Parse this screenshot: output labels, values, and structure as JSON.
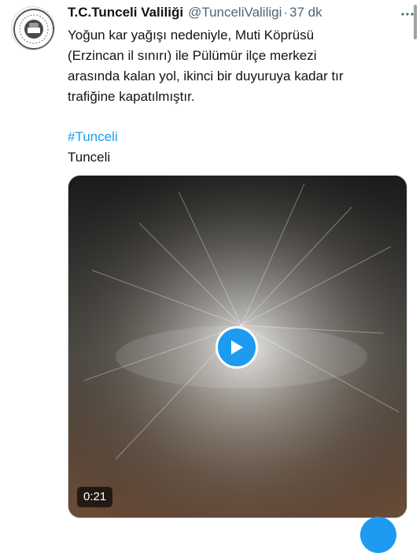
{
  "author": {
    "name": "T.C.Tunceli Valiliği",
    "handle": "@TunceliValiligi",
    "separator": "·",
    "time": "37 dk"
  },
  "tweet": {
    "text": "Yoğun kar yağışı nedeniyle, Muti Köprüsü\n(Erzincan il sınırı) ile Pülümür ilçe merkezi\narasında kalan yol, ikinci bir duyuruya kadar tır\ntrafiğine kapatılmıştır.",
    "hashtag": "#Tunceli",
    "location": "Tunceli"
  },
  "media": {
    "type": "video",
    "duration": "0:21"
  },
  "icons": {
    "more": "more-icon",
    "play": "play-icon",
    "avatar_seal": "seal-logo"
  },
  "colors": {
    "accent": "#1d9bf0",
    "text": "#0f1419",
    "muted": "#536471"
  }
}
